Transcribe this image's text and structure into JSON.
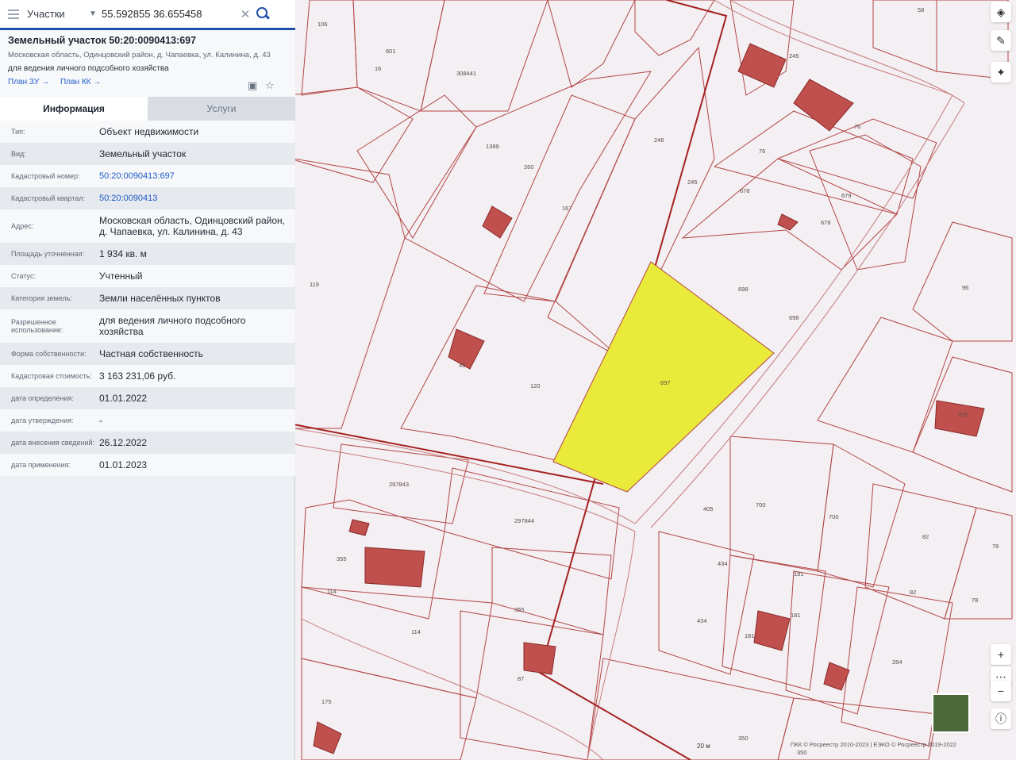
{
  "search": {
    "type_label": "Участки",
    "value": "55.592855 36.655458"
  },
  "object": {
    "title": "Земельный участок 50:20:0090413:697",
    "address_short": "Московская область, Одинцовский район, д. Чапаевка, ул. Калинина, д. 43",
    "usage": "для ведения личного подсобного хозяйства",
    "link_plan_zu": "План ЗУ →",
    "link_plan_kk": "План КК →"
  },
  "tabs": [
    {
      "label": "Информация"
    },
    {
      "label": "Услуги"
    }
  ],
  "props": [
    {
      "key": "Тип:",
      "value": "Объект недвижимости"
    },
    {
      "key": "Вид:",
      "value": "Земельный участок"
    },
    {
      "key": "Кадастровый номер:",
      "value": "50:20:0090413:697"
    },
    {
      "key": "Кадастровый квартал:",
      "value": "50:20:0090413"
    },
    {
      "key": "Адрес:",
      "value": "Московская область, Одинцовский район, д. Чапаевка, ул. Калинина, д. 43"
    },
    {
      "key": "Площадь уточненная:",
      "value": "1 934 кв. м"
    },
    {
      "key": "Статус:",
      "value": "Учтенный"
    },
    {
      "key": "Категория земель:",
      "value": "Земли населённых пунктов"
    },
    {
      "key": "Разрешенное использование:",
      "value": "для ведения личного подсобного хозяйства"
    },
    {
      "key": "Форма собственности:",
      "value": "Частная собственность"
    },
    {
      "key": "Кадастровая стоимость:",
      "value": "3 163 231,06 руб."
    },
    {
      "key": "дата определения:",
      "value": "01.01.2022"
    },
    {
      "key": "дата утверждения:",
      "value": "-"
    },
    {
      "key": "дата внесения сведений:",
      "value": "26.12.2022"
    },
    {
      "key": "дата применения:",
      "value": "01.01.2023"
    }
  ],
  "map_labels": [
    "106",
    "601",
    "16",
    "308441",
    "58",
    "245",
    "76",
    "1389",
    "260",
    "246",
    "245",
    "76",
    "678",
    "679",
    "678",
    "167",
    "119",
    "698",
    "698",
    "96",
    "45",
    "120",
    "697",
    "209",
    "297843",
    "297844",
    "405",
    "700",
    "700",
    "82",
    "78",
    "355",
    "114",
    "434",
    "181",
    "181",
    "82",
    "78",
    "355",
    "114",
    "434",
    "181",
    "284",
    "87",
    "175",
    "350",
    "350"
  ],
  "map": {
    "scale": "20 м",
    "copyright": "ПКК © Росреестр 2010-2023 | ЕЭКО © Росреестр 2019-2022"
  },
  "colors": {
    "accent": "#1f4fa8",
    "parcel_stroke": "#b23a3a",
    "building_fill": "#c0504d",
    "selected_fill": "#eaea3a"
  }
}
